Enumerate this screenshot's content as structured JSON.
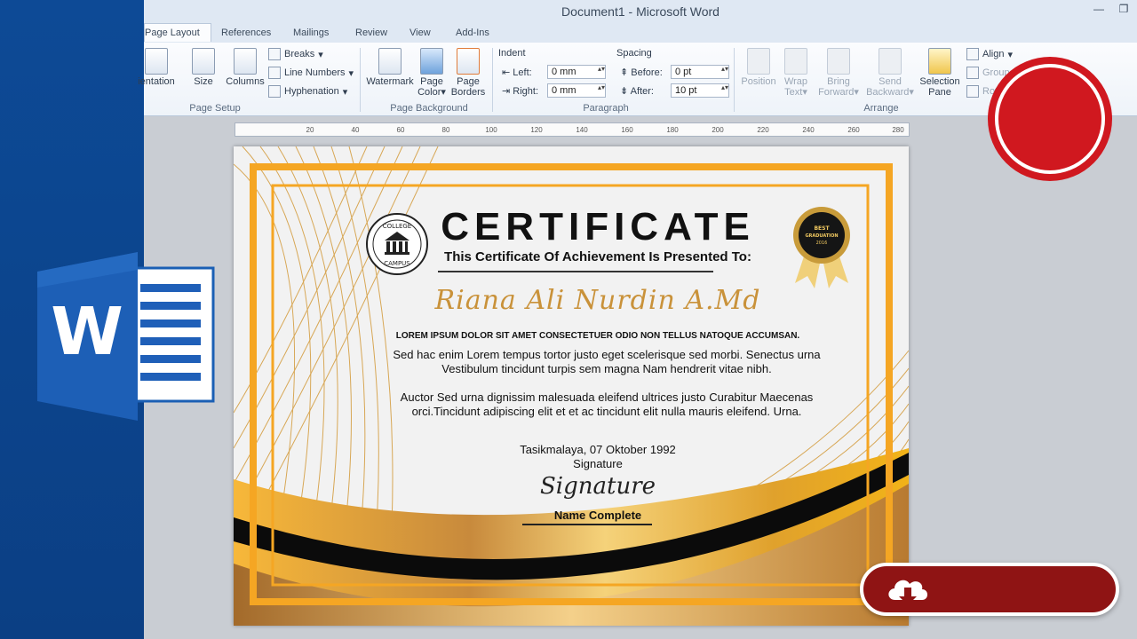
{
  "window": {
    "title": "Document1  -  Microsoft Word",
    "controls": [
      "minimize",
      "restore"
    ]
  },
  "tabs": [
    {
      "label": "Page Layout",
      "active": true
    },
    {
      "label": "References"
    },
    {
      "label": "Mailings"
    },
    {
      "label": "Review"
    },
    {
      "label": "View"
    },
    {
      "label": "Add-Ins"
    }
  ],
  "ribbon": {
    "page_setup": {
      "orientation": "ientation",
      "size": "Size",
      "columns": "Columns",
      "breaks": "Breaks",
      "line_numbers": "Line Numbers",
      "hyphenation": "Hyphenation",
      "label": "Page Setup"
    },
    "page_background": {
      "watermark": "Watermark",
      "page_color_1": "Page",
      "page_color_2": "Color",
      "page_borders_1": "Page",
      "page_borders_2": "Borders",
      "label": "Page Background"
    },
    "paragraph": {
      "indent_title": "Indent",
      "left_label": "Left:",
      "left_value": "0 mm",
      "right_label": "Right:",
      "right_value": "0 mm",
      "spacing_title": "Spacing",
      "before_label": "Before:",
      "before_value": "0 pt",
      "after_label": "After:",
      "after_value": "10 pt",
      "label": "Paragraph"
    },
    "arrange": {
      "position": "Position",
      "wrap_1": "Wrap",
      "wrap_2": "Text",
      "bring_1": "Bring",
      "bring_2": "Forward",
      "send_1": "Send",
      "send_2": "Backward",
      "selection_1": "Selection",
      "selection_2": "Pane",
      "align": "Align",
      "group": "Group",
      "rotate": "Rot",
      "label": "Arrange"
    }
  },
  "ruler": {
    "ticks": [
      "20",
      "40",
      "60",
      "80",
      "100",
      "120",
      "140",
      "160",
      "180",
      "200",
      "220",
      "240",
      "260",
      "280"
    ]
  },
  "certificate": {
    "seal_top": "COLLEGE",
    "seal_bottom": "CAMPUS",
    "badge_line1": "BEST",
    "badge_line2": "GRADUATION",
    "badge_line3": "2016",
    "title": "CERTIFICATE",
    "subtitle": "This Certificate Of Achievement Is Presented To:",
    "recipient": "Riana Ali Nurdin  A.Md",
    "heading": "LOREM IPSUM DOLOR SIT AMET CONSECTETUER ODIO NON TELLUS NATOQUE ACCUMSAN.",
    "paragraph1": "Sed hac enim Lorem tempus tortor justo eget scelerisque sed morbi. Senectus urna Vestibulum tincidunt turpis sem magna Nam hendrerit vitae nibh.",
    "paragraph2": "Auctor Sed urna dignissim malesuada eleifend ultrices justo Curabitur Maecenas orci.Tincidunt adipiscing elit et et ac tincidunt elit nulla mauris eleifend. Urna.",
    "place_date": "Tasikmalaya, 07 Oktober 1992",
    "signature_label": "Signature",
    "signature_script": "Signature",
    "name_complete": "Name Complete"
  },
  "colors": {
    "word_blue": "#0d4a96",
    "gold": "#f2a71c",
    "record_red": "#d0181f",
    "download_red": "#8f1414"
  },
  "icons": [
    "word-logo-icon",
    "record-icon",
    "cloud-download-icon"
  ]
}
